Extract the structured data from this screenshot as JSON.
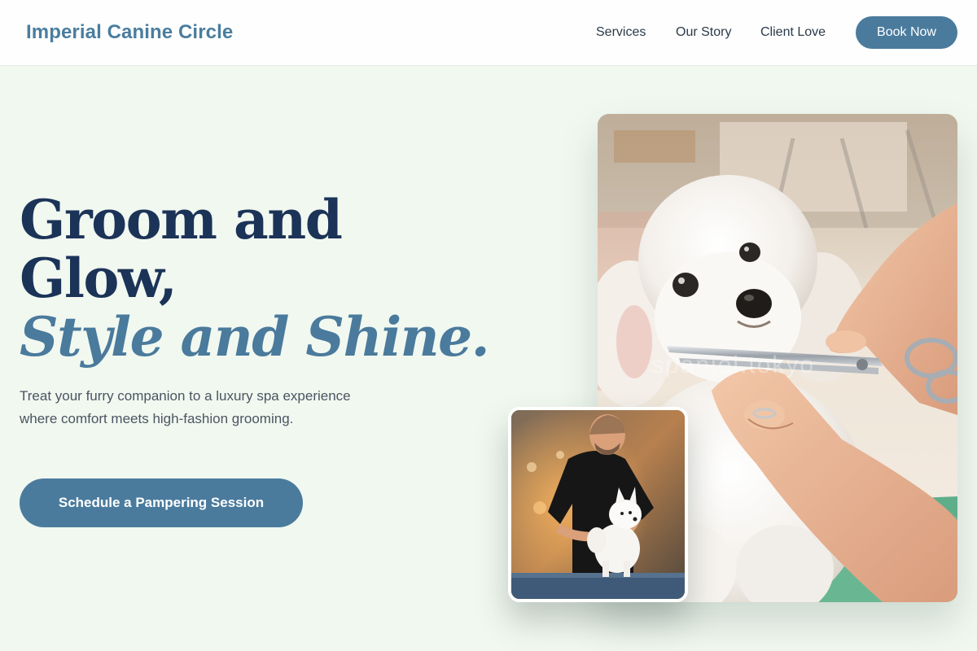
{
  "header": {
    "brand": "Imperial Canine Circle",
    "nav": {
      "services": "Services",
      "story": "Our Story",
      "love": "Client Love"
    },
    "cta_label": "Book Now"
  },
  "hero": {
    "headline_line1": "Groom and",
    "headline_line2": "Glow,",
    "headline_accent": "Style and Shine.",
    "subtext": "Treat your furry companion to a luxury spa experience where comfort meets high-fashion grooming.",
    "cta_label": "Schedule a Pampering Session"
  },
  "images": {
    "main_watermark": "spaniel.tokyo"
  },
  "colors": {
    "page_background": "#f1f8f0",
    "header_background": "#fdfefd",
    "brand": "#4a7d9f",
    "button": "#4a7b9d",
    "headline": "#1c3358",
    "headline_accent": "#4a7a9c",
    "body_text": "#4a5561"
  }
}
